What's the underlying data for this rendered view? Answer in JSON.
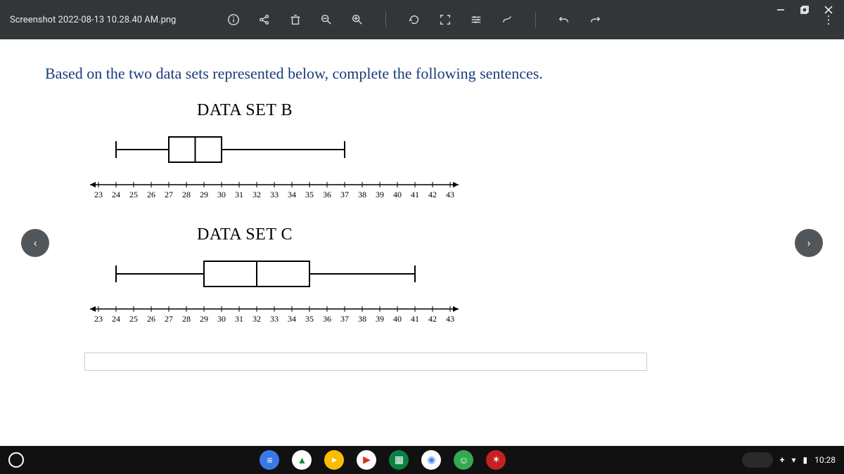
{
  "window_controls": {
    "minimize": "—",
    "restore": "❐",
    "close": "✕"
  },
  "toolbar": {
    "filename": "Screenshot 2022-08-13 10.28.40 AM.png",
    "icons": [
      "info",
      "share",
      "delete",
      "zoom-out",
      "zoom-in",
      "rotate",
      "fullscreen",
      "tune",
      "annotate",
      "undo",
      "redo"
    ],
    "menu": "⋮"
  },
  "content": {
    "prompt": "Based on the two data sets represented below, complete the following sentences.",
    "sets": {
      "B": {
        "title": "DATA SET B"
      },
      "C": {
        "title": "DATA SET C"
      }
    },
    "axis_labels": [
      "23",
      "24",
      "25",
      "26",
      "27",
      "28",
      "29",
      "30",
      "31",
      "32",
      "33",
      "34",
      "35",
      "36",
      "37",
      "38",
      "39",
      "40",
      "41",
      "42",
      "43"
    ]
  },
  "chart_data": [
    {
      "type": "boxplot",
      "name": "DATA SET B",
      "min": 24,
      "q1": 27,
      "median": 28.5,
      "q3": 30,
      "max": 37,
      "axis": {
        "min": 23,
        "max": 43,
        "step": 1
      }
    },
    {
      "type": "boxplot",
      "name": "DATA SET C",
      "min": 24,
      "q1": 29,
      "median": 32,
      "q3": 35,
      "max": 41,
      "axis": {
        "min": 23,
        "max": 43,
        "step": 1
      }
    }
  ],
  "nav": {
    "prev": "‹",
    "next": "›"
  },
  "taskbar": {
    "apps": [
      {
        "bg": "#3b78e7",
        "sym": "≡"
      },
      {
        "bg": "#ffffff",
        "sym": "▲",
        "fg": "#0a8f3c"
      },
      {
        "bg": "#fbbc04",
        "sym": "▸"
      },
      {
        "bg": "#ffffff",
        "sym": "▶",
        "fg": "#d93025"
      },
      {
        "bg": "#0b8043",
        "sym": "▦"
      },
      {
        "bg": "#ffffff",
        "sym": "◉",
        "fg": "#4285f4"
      },
      {
        "bg": "#34a853",
        "sym": "☺"
      },
      {
        "bg": "#c5221f",
        "sym": "✶"
      }
    ],
    "status": {
      "time": "10:28",
      "wifi": "▾",
      "battery": "▮",
      "add": "+"
    }
  }
}
